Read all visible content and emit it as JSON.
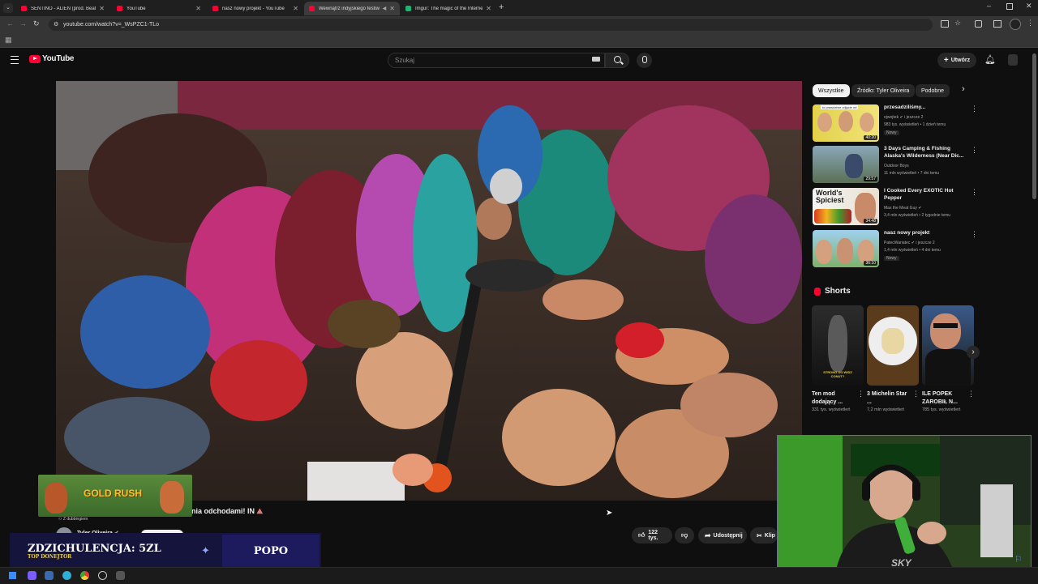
{
  "browser": {
    "tabs": [
      {
        "label": "SENTINO - ALIEN (prod. Beathoven)",
        "active": false
      },
      {
        "label": "YouTube",
        "active": false
      },
      {
        "label": "nasz nowy projekt - YouTube",
        "active": false
      },
      {
        "label": "Wewnątrz indyjskiego festiwalu",
        "active": true
      },
      {
        "label": "Imgur: The magic of the Internet",
        "active": false
      }
    ],
    "url": "youtube.com/watch?v=_WsPZC1-TLo"
  },
  "youtube": {
    "logo_text": "YouTube",
    "search_placeholder": "Szukaj",
    "create_label": "Utwórz"
  },
  "chips": [
    "Wszystkie",
    "Źródło: Tyler Oliveira",
    "Podobne"
  ],
  "recommendations": [
    {
      "title": "przesadziliśmy...",
      "channel": "ojwojtek",
      "channel_suffix": "i jeszcze 2",
      "meta": "983 tys. wyświetleń • 1 dzień temu",
      "badge": "Nowy",
      "duration": "40:20",
      "thumb_text": "to prawdziwe zdjęcie od"
    },
    {
      "title": "3 Days Camping & Fishing Alaska's Wilderness (Near Dic...",
      "channel": "Outdoor Boys",
      "channel_suffix": "",
      "meta": "11 mln wyświetleń • 7 dni temu",
      "badge": "",
      "duration": "29:57",
      "thumb_text": ""
    },
    {
      "title": "I Cooked Every EXOTIC Hot Pepper",
      "channel": "Max the Meat Guy",
      "channel_suffix": "",
      "meta": "3,4 mln wyświetleń • 2 tygodnie temu",
      "badge": "",
      "duration": "34:48",
      "thumb_text": "World's Spiciest"
    },
    {
      "title": "nasz nowy projekt",
      "channel": "PatecWariatec",
      "channel_suffix": "i jeszcze 2",
      "meta": "1,4 mln wyświetleń • 4 dni temu",
      "badge": "Nowy",
      "duration": "36:10",
      "thumb_text": ""
    }
  ],
  "shorts": {
    "heading": "Shorts",
    "items": [
      {
        "title": "Ten mod dodający ...",
        "views": "331 tys. wyświetleń",
        "thumb_text": "STRONG DO WIDZ CONUT?"
      },
      {
        "title": "3 Michelin Star ...",
        "views": "7,2 mln wyświetleń",
        "thumb_text": ""
      },
      {
        "title": "ILE POPEK ZAROBIŁ N...",
        "views": "785 tys. wyświetleń",
        "thumb_text": ""
      }
    ]
  },
  "video": {
    "title_visible": "nia odchodami! IN",
    "dubbing": "Z dubbingiem",
    "channel": "Tyler Oliveira",
    "likes": "122 tys.",
    "share_label": "Udostępnij",
    "clip_label": "Klip"
  },
  "overlay": {
    "game_banner": "GOLD RUSH",
    "donate_main": "ZDZICHULENCJA: 5ZL",
    "donate_sub": "TOP DONEJTOR",
    "donate_name": "POPO",
    "webcam_shirt": "SKY"
  }
}
